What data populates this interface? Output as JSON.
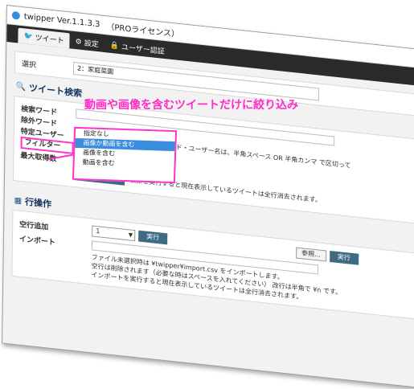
{
  "window": {
    "title": "twipper Ver.1.1.3.3",
    "edition": "（PROライセンス）"
  },
  "tabs": [
    {
      "label": "ツイート",
      "icon": "twitter-icon"
    },
    {
      "label": "設定",
      "icon": "gear-icon"
    },
    {
      "label": "ユーザー認証",
      "icon": "lock-icon"
    }
  ],
  "selection": {
    "label": "選択",
    "value": "2：家庭菜園"
  },
  "tweet_search": {
    "heading": "ツイート検索",
    "keyword_label": "検索ワード",
    "exclude_label": "除外ワード",
    "user_label": "特定ユーザー",
    "filter_label": "フィルター",
    "max_label": "最大取得数",
    "hint": "↑キーワード・ユーザー名は、半角スペース OR 半角カンマ で区切って",
    "search_button": "検索実行",
    "search_note": "検索を実行すると現在表示しているツイートは全行消去されます。"
  },
  "filter_dropdown": {
    "options": [
      "指定なし",
      "画像か動画を含む",
      "画像を含む",
      "動画を含む"
    ],
    "selected_index": 1
  },
  "annotation": "動画や画像を含むツイートだけに絞り込み",
  "row_ops": {
    "heading": "行操作",
    "add_label": "空行追加",
    "add_value": "1",
    "run_label": "実行",
    "import_label": "インポート",
    "browse_label": "参照...",
    "run2_label": "実行",
    "note1": "ファイル未選択時は ¥twipper¥import.csv をインポートします。",
    "note2": "空行は削除されます（必要な時はスペースを入れてください） 改行は半角で ¥n です。",
    "note3": "インポートを実行すると現在表示しているツイートは全行消去されます。"
  }
}
